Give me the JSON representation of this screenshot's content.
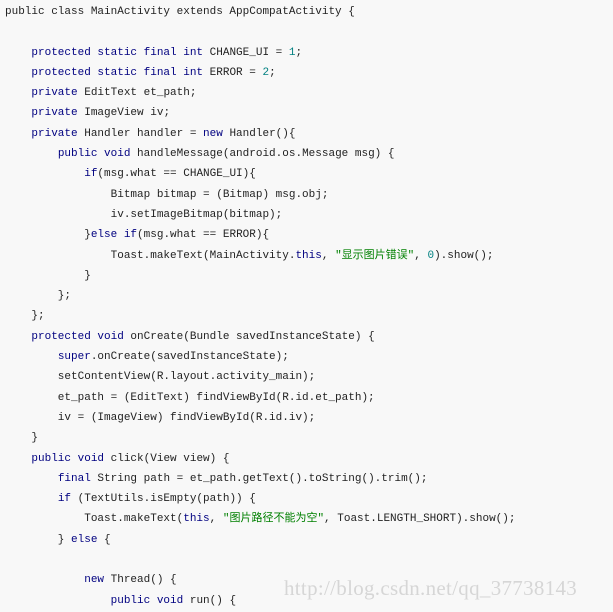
{
  "code_lines": [
    [
      [
        "p",
        "public class MainActivity extends AppCompatActivity {"
      ]
    ],
    [],
    [
      [
        "p",
        "    "
      ],
      [
        "k",
        "protected static final int"
      ],
      [
        "p",
        " CHANGE_UI = "
      ],
      [
        "n",
        "1"
      ],
      [
        "p",
        ";"
      ]
    ],
    [
      [
        "p",
        "    "
      ],
      [
        "k",
        "protected static final int"
      ],
      [
        "p",
        " ERROR = "
      ],
      [
        "n",
        "2"
      ],
      [
        "p",
        ";"
      ]
    ],
    [
      [
        "p",
        "    "
      ],
      [
        "k",
        "private"
      ],
      [
        "p",
        " EditText et_path;"
      ]
    ],
    [
      [
        "p",
        "    "
      ],
      [
        "k",
        "private"
      ],
      [
        "p",
        " ImageView iv;"
      ]
    ],
    [
      [
        "p",
        "    "
      ],
      [
        "k",
        "private"
      ],
      [
        "p",
        " Handler handler = "
      ],
      [
        "k",
        "new"
      ],
      [
        "p",
        " Handler(){"
      ]
    ],
    [
      [
        "p",
        "        "
      ],
      [
        "k",
        "public void"
      ],
      [
        "p",
        " handleMessage(android.os.Message msg) {"
      ]
    ],
    [
      [
        "p",
        "            "
      ],
      [
        "k",
        "if"
      ],
      [
        "p",
        "(msg.what == CHANGE_UI){"
      ]
    ],
    [
      [
        "p",
        "                Bitmap bitmap = (Bitmap) msg.obj;"
      ]
    ],
    [
      [
        "p",
        "                iv.setImageBitmap(bitmap);"
      ]
    ],
    [
      [
        "p",
        "            }"
      ],
      [
        "k",
        "else if"
      ],
      [
        "p",
        "(msg.what == ERROR){"
      ]
    ],
    [
      [
        "p",
        "                Toast.makeText(MainActivity."
      ],
      [
        "k",
        "this"
      ],
      [
        "p",
        ", "
      ],
      [
        "s",
        "\"显示图片错误\""
      ],
      [
        "p",
        ", "
      ],
      [
        "n",
        "0"
      ],
      [
        "p",
        ").show();"
      ]
    ],
    [
      [
        "p",
        "            }"
      ]
    ],
    [
      [
        "p",
        "        };"
      ]
    ],
    [
      [
        "p",
        "    };"
      ]
    ],
    [
      [
        "p",
        "    "
      ],
      [
        "k",
        "protected void"
      ],
      [
        "p",
        " onCreate(Bundle savedInstanceState) {"
      ]
    ],
    [
      [
        "p",
        "        "
      ],
      [
        "k",
        "super"
      ],
      [
        "p",
        ".onCreate(savedInstanceState);"
      ]
    ],
    [
      [
        "p",
        "        setContentView(R.layout.activity_main);"
      ]
    ],
    [
      [
        "p",
        "        et_path = (EditText) findViewById(R.id.et_path);"
      ]
    ],
    [
      [
        "p",
        "        iv = (ImageView) findViewById(R.id.iv);"
      ]
    ],
    [
      [
        "p",
        "    }"
      ]
    ],
    [
      [
        "p",
        "    "
      ],
      [
        "k",
        "public void"
      ],
      [
        "p",
        " click(View view) {"
      ]
    ],
    [
      [
        "p",
        "        "
      ],
      [
        "k",
        "final"
      ],
      [
        "p",
        " String path = et_path.getText().toString().trim();"
      ]
    ],
    [
      [
        "p",
        "        "
      ],
      [
        "k",
        "if"
      ],
      [
        "p",
        " (TextUtils.isEmpty(path)) {"
      ]
    ],
    [
      [
        "p",
        "            Toast.makeText("
      ],
      [
        "k",
        "this"
      ],
      [
        "p",
        ", "
      ],
      [
        "s",
        "\"图片路径不能为空\""
      ],
      [
        "p",
        ", Toast.LENGTH_SHORT).show();"
      ]
    ],
    [
      [
        "p",
        "        } "
      ],
      [
        "k",
        "else"
      ],
      [
        "p",
        " {"
      ]
    ],
    [],
    [
      [
        "p",
        "            "
      ],
      [
        "k",
        "new"
      ],
      [
        "p",
        " Thread() {"
      ]
    ],
    [
      [
        "p",
        "                "
      ],
      [
        "k",
        "public void"
      ],
      [
        "p",
        " run() {"
      ]
    ]
  ],
  "watermark": "http://blog.csdn.net/qq_37738143",
  "colors": {
    "keyword": "#000080",
    "number": "#008080",
    "string": "#008000",
    "background": "#f8f8f8"
  }
}
